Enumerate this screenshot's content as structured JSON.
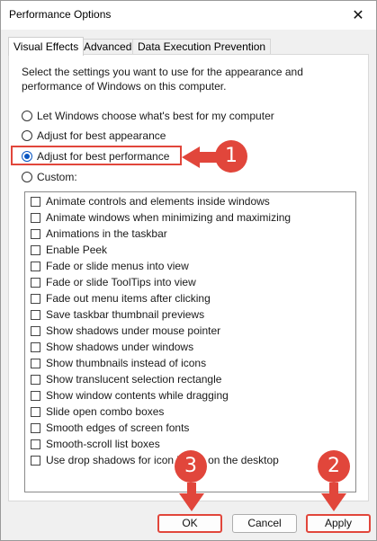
{
  "window": {
    "title": "Performance Options"
  },
  "tabs": [
    {
      "label": "Visual Effects"
    },
    {
      "label": "Advanced"
    },
    {
      "label": "Data Execution Prevention"
    }
  ],
  "description": "Select the settings you want to use for the appearance and performance of Windows on this computer.",
  "radios": [
    {
      "label": "Let Windows choose what's best for my computer"
    },
    {
      "label": "Adjust for best appearance"
    },
    {
      "label": "Adjust for best performance"
    },
    {
      "label": "Custom:"
    }
  ],
  "options": [
    "Animate controls and elements inside windows",
    "Animate windows when minimizing and maximizing",
    "Animations in the taskbar",
    "Enable Peek",
    "Fade or slide menus into view",
    "Fade or slide ToolTips into view",
    "Fade out menu items after clicking",
    "Save taskbar thumbnail previews",
    "Show shadows under mouse pointer",
    "Show shadows under windows",
    "Show thumbnails instead of icons",
    "Show translucent selection rectangle",
    "Show window contents while dragging",
    "Slide open combo boxes",
    "Smooth edges of screen fonts",
    "Smooth-scroll list boxes",
    "Use drop shadows for icon labels on the desktop"
  ],
  "buttons": {
    "ok": "OK",
    "cancel": "Cancel",
    "apply": "Apply"
  },
  "annotations": {
    "step1": "1",
    "step2": "2",
    "step3": "3"
  },
  "colors": {
    "annotation": "#e1463b",
    "radio_selected": "#0a56c2"
  }
}
